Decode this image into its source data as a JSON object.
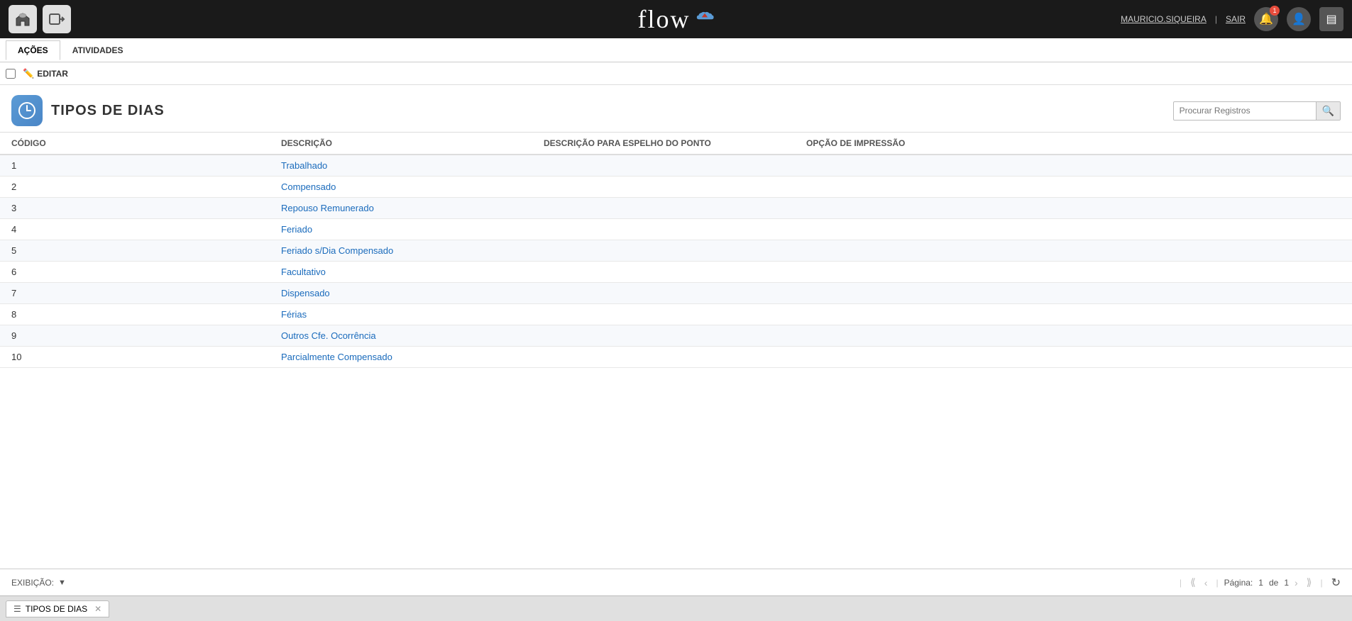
{
  "navbar": {
    "logo_text": "flow",
    "user_name": "MAURICIO.SIQUEIRA",
    "separator": "|",
    "logout_label": "SAIR",
    "notification_count": "1"
  },
  "tabs": [
    {
      "id": "acoes",
      "label": "AÇÕES",
      "active": true
    },
    {
      "id": "atividades",
      "label": "ATIVIDADES",
      "active": false
    }
  ],
  "toolbar": {
    "edit_label": "EDITAR"
  },
  "page": {
    "title": "TIPOS DE DIAS",
    "search_placeholder": "Procurar Registros"
  },
  "table": {
    "columns": [
      {
        "id": "codigo",
        "label": "CÓDIGO"
      },
      {
        "id": "descricao",
        "label": "DESCRIÇÃO"
      },
      {
        "id": "descricao_espelho",
        "label": "DESCRIÇÃO PARA ESPELHO DO PONTO"
      },
      {
        "id": "opcao_impressao",
        "label": "OPÇÃO DE IMPRESSÃO"
      }
    ],
    "rows": [
      {
        "codigo": "1",
        "descricao": "Trabalhado",
        "descricao_espelho": "",
        "opcao_impressao": ""
      },
      {
        "codigo": "2",
        "descricao": "Compensado",
        "descricao_espelho": "",
        "opcao_impressao": ""
      },
      {
        "codigo": "3",
        "descricao": "Repouso Remunerado",
        "descricao_espelho": "",
        "opcao_impressao": ""
      },
      {
        "codigo": "4",
        "descricao": "Feriado",
        "descricao_espelho": "",
        "opcao_impressao": ""
      },
      {
        "codigo": "5",
        "descricao": "Feriado s/Dia Compensado",
        "descricao_espelho": "",
        "opcao_impressao": ""
      },
      {
        "codigo": "6",
        "descricao": "Facultativo",
        "descricao_espelho": "",
        "opcao_impressao": ""
      },
      {
        "codigo": "7",
        "descricao": "Dispensado",
        "descricao_espelho": "",
        "opcao_impressao": ""
      },
      {
        "codigo": "8",
        "descricao": "Férias",
        "descricao_espelho": "",
        "opcao_impressao": ""
      },
      {
        "codigo": "9",
        "descricao": "Outros Cfe. Ocorrência",
        "descricao_espelho": "",
        "opcao_impressao": ""
      },
      {
        "codigo": "10",
        "descricao": "Parcialmente Compensado",
        "descricao_espelho": "",
        "opcao_impressao": ""
      }
    ]
  },
  "footer": {
    "exibicao_label": "EXIBIÇÃO:",
    "page_label": "Página:",
    "page_current": "1",
    "page_separator": "de",
    "page_total": "1"
  },
  "bottom_tab": {
    "label": "TIPOS DE DIAS"
  }
}
